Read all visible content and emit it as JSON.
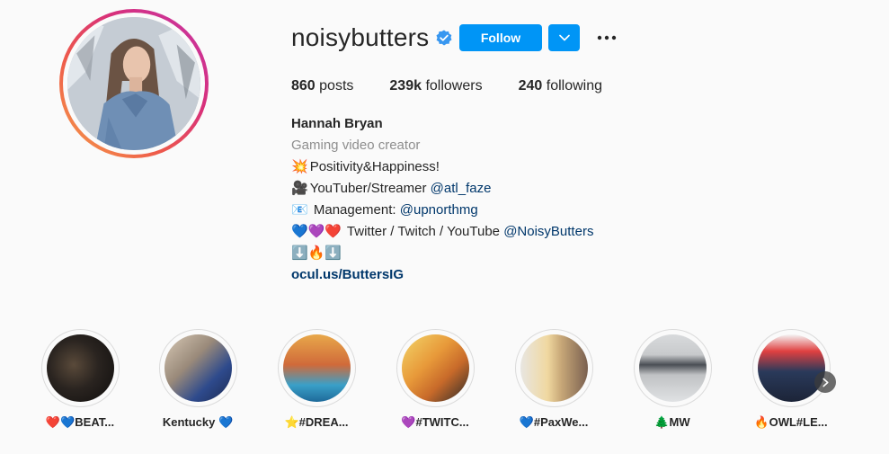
{
  "profile": {
    "username": "noisybutters",
    "verified": true,
    "follow_label": "Follow",
    "accent_color": "#0095f6"
  },
  "stats": {
    "posts_count": "860",
    "posts_label": "posts",
    "followers_count": "239k",
    "followers_label": "followers",
    "following_count": "240",
    "following_label": "following"
  },
  "bio": {
    "name": "Hannah Bryan",
    "category": "Gaming video creator",
    "line1_emoji": "💥",
    "line1_text": "Positivity&Happiness!",
    "line2_emoji": "🎥",
    "line2_text": "YouTuber/Streamer ",
    "line2_mention": "@atl_faze",
    "line3_emoji": "📧",
    "line3_text": " Management: ",
    "line3_mention": "@upnorthmg",
    "line4_emoji": "💙💜❤️",
    "line4_text": " Twitter / Twitch / YouTube ",
    "line4_mention": "@NoisyButters",
    "line5_emoji": "⬇️🔥⬇️",
    "link": "ocul.us/ButtersIG"
  },
  "highlights": [
    {
      "label": "❤️💙BEAT..."
    },
    {
      "label": "Kentucky 💙"
    },
    {
      "label": "⭐#DREA..."
    },
    {
      "label": "💜#TWITC..."
    },
    {
      "label": "💙#PaxWe..."
    },
    {
      "label": "🌲MW"
    },
    {
      "label": "🔥OWL#LE..."
    }
  ]
}
